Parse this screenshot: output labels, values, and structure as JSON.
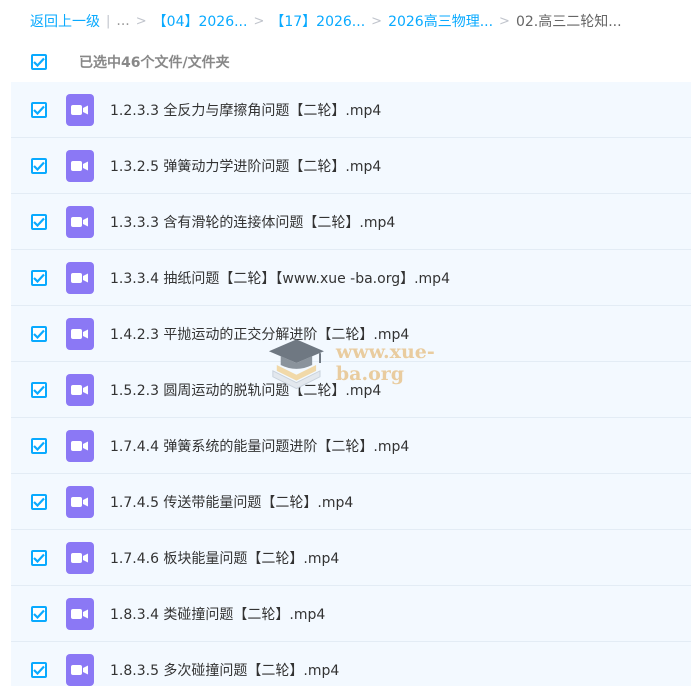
{
  "breadcrumb": {
    "back": "返回上一级",
    "ellipsis": "...",
    "items": [
      "【04】2026...",
      "【17】2026...",
      "2026高三物理..."
    ],
    "current": "02.高三二轮知..."
  },
  "selection": {
    "label": "已选中46个文件/文件夹",
    "all_checked": true
  },
  "files": [
    {
      "name": "1.2.3.3 全反力与摩擦角问题【二轮】.mp4",
      "checked": true
    },
    {
      "name": "1.3.2.5 弹簧动力学进阶问题【二轮】.mp4",
      "checked": true
    },
    {
      "name": "1.3.3.3 含有滑轮的连接体问题【二轮】.mp4",
      "checked": true
    },
    {
      "name": "1.3.3.4 抽纸问题【二轮】【www.xue -ba.org】.mp4",
      "checked": true
    },
    {
      "name": "1.4.2.3 平抛运动的正交分解进阶【二轮】.mp4",
      "checked": true
    },
    {
      "name": "1.5.2.3 圆周运动的脱轨问题【二轮】.mp4",
      "checked": true
    },
    {
      "name": "1.7.4.4 弹簧系统的能量问题进阶【二轮】.mp4",
      "checked": true
    },
    {
      "name": "1.7.4.5 传送带能量问题【二轮】.mp4",
      "checked": true
    },
    {
      "name": "1.7.4.6 板块能量问题【二轮】.mp4",
      "checked": true
    },
    {
      "name": "1.8.3.4 类碰撞问题【二轮】.mp4",
      "checked": true
    },
    {
      "name": "1.8.3.5 多次碰撞问题【二轮】.mp4",
      "checked": true
    }
  ],
  "watermark": {
    "text": "www.xue-ba.org"
  },
  "icons": {
    "checkbox": "checkbox-checked-icon",
    "file": "video-file-icon",
    "logo": "graduation-cap-icon"
  },
  "colors": {
    "accent": "#09aaff",
    "video_icon": "#8b78f5",
    "list_bg": "#f3f9ff",
    "watermark": "#e8c58f"
  }
}
